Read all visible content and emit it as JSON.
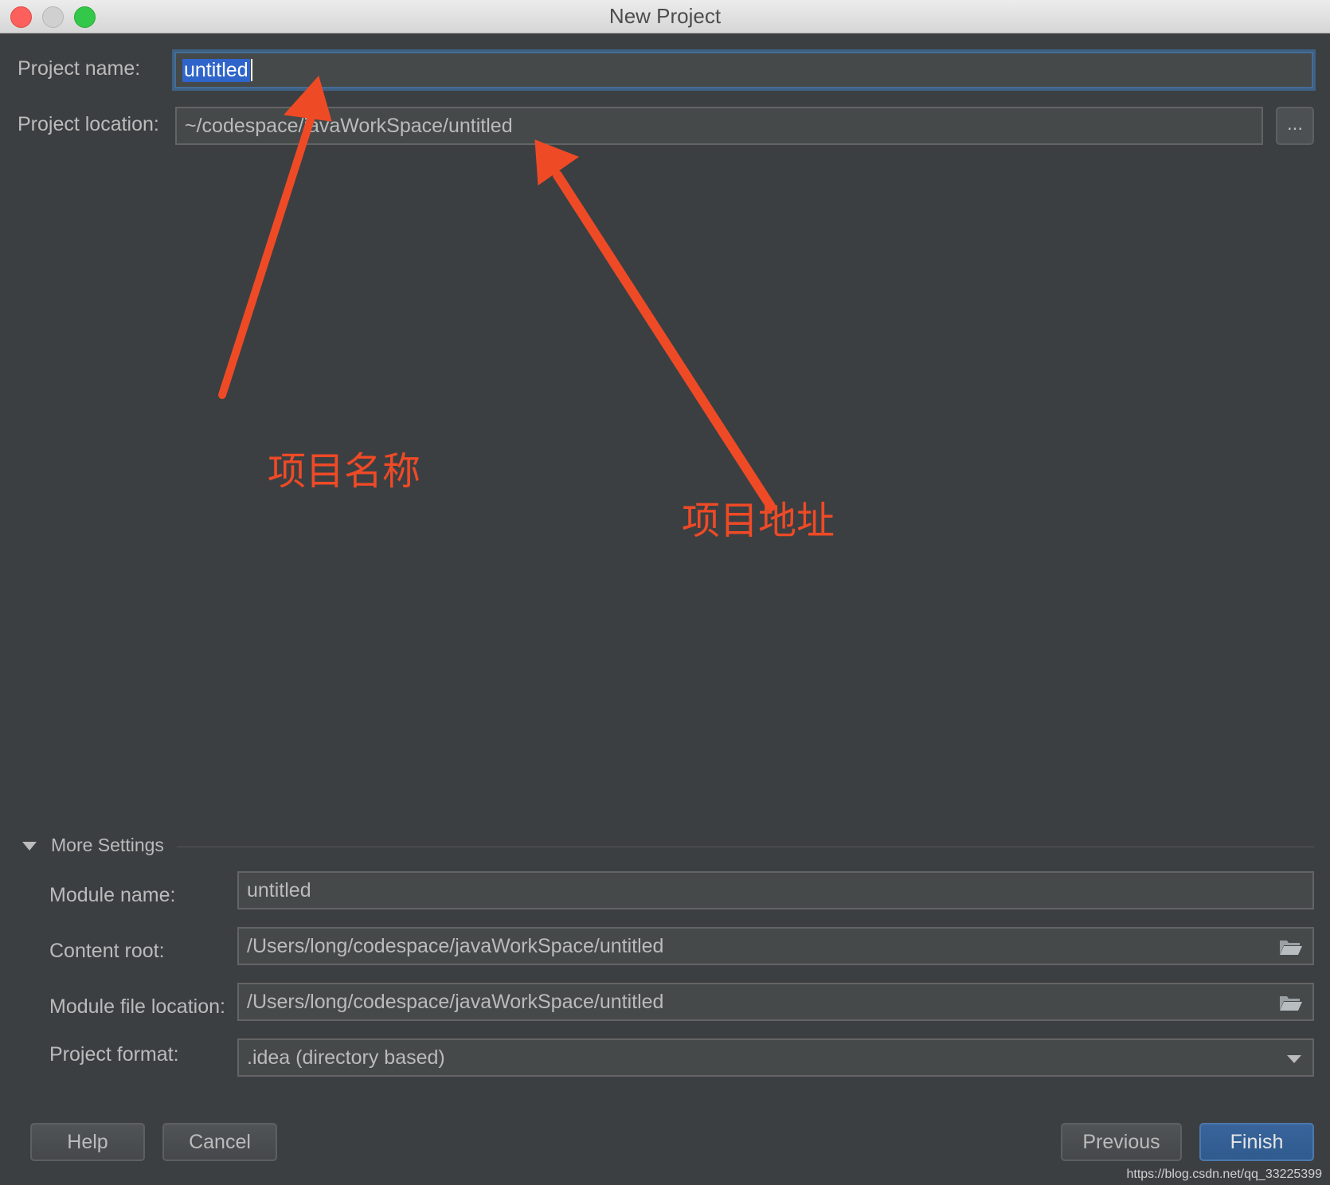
{
  "window": {
    "title": "New Project"
  },
  "form": {
    "project_name_label": "Project name:",
    "project_name_value": "untitled",
    "project_location_label": "Project location:",
    "project_location_value": "~/codespace/javaWorkSpace/untitled",
    "browse_label": "..."
  },
  "more_settings": {
    "title": "More Settings",
    "module_name_label": "Module name:",
    "module_name_value": "untitled",
    "content_root_label": "Content root:",
    "content_root_value": "/Users/long/codespace/javaWorkSpace/untitled",
    "module_file_location_label": "Module file location:",
    "module_file_location_value": "/Users/long/codespace/javaWorkSpace/untitled",
    "project_format_label": "Project format:",
    "project_format_value": ".idea (directory based)"
  },
  "buttons": {
    "help": "Help",
    "cancel": "Cancel",
    "previous": "Previous",
    "finish": "Finish"
  },
  "annotations": {
    "project_name_note": "项目名称",
    "project_location_note": "项目地址"
  },
  "watermark": "https://blog.csdn.net/qq_33225399",
  "colors": {
    "background": "#3c3f41",
    "field_bg": "#45494a",
    "selection": "#2f65ca",
    "primary_button": "#2f5b8f",
    "annotation": "#ef4a26"
  },
  "icons": [
    "close-window-icon",
    "minimize-window-icon",
    "zoom-window-icon",
    "folder-icon",
    "dropdown-arrow-icon",
    "collapse-triangle-icon"
  ]
}
